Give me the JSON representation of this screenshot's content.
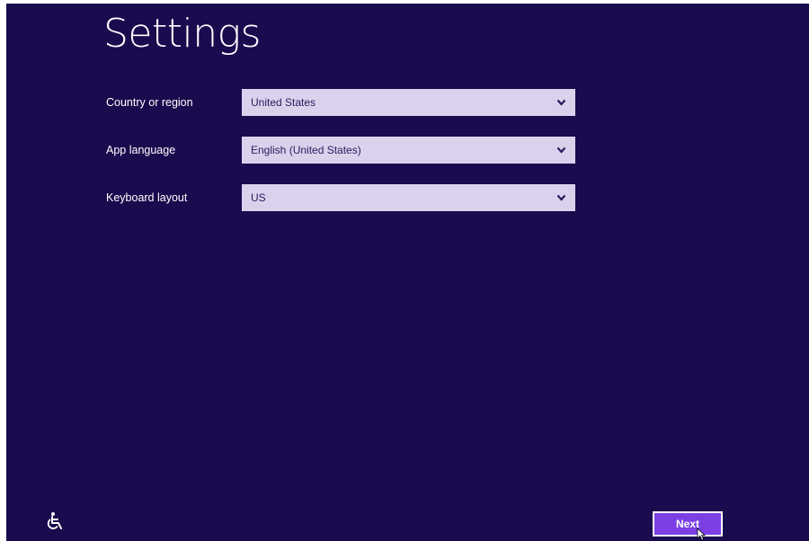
{
  "page": {
    "title": "Settings"
  },
  "form": {
    "fields": [
      {
        "label": "Country or region",
        "value": "United States"
      },
      {
        "label": "App language",
        "value": "English (United States)"
      },
      {
        "label": "Keyboard layout",
        "value": "US"
      }
    ]
  },
  "footer": {
    "ease_of_access_icon": "ease-of-access-icon",
    "next_label": "Next"
  },
  "icons": {
    "dropdown": "chevron-down-icon",
    "pointer": "mouse-pointer-icon"
  },
  "colors": {
    "background": "#1a0a4e",
    "select_background": "#dcd1ec",
    "select_text": "#2a1a5e",
    "accent": "#7b3fe4",
    "text": "#ffffff"
  }
}
